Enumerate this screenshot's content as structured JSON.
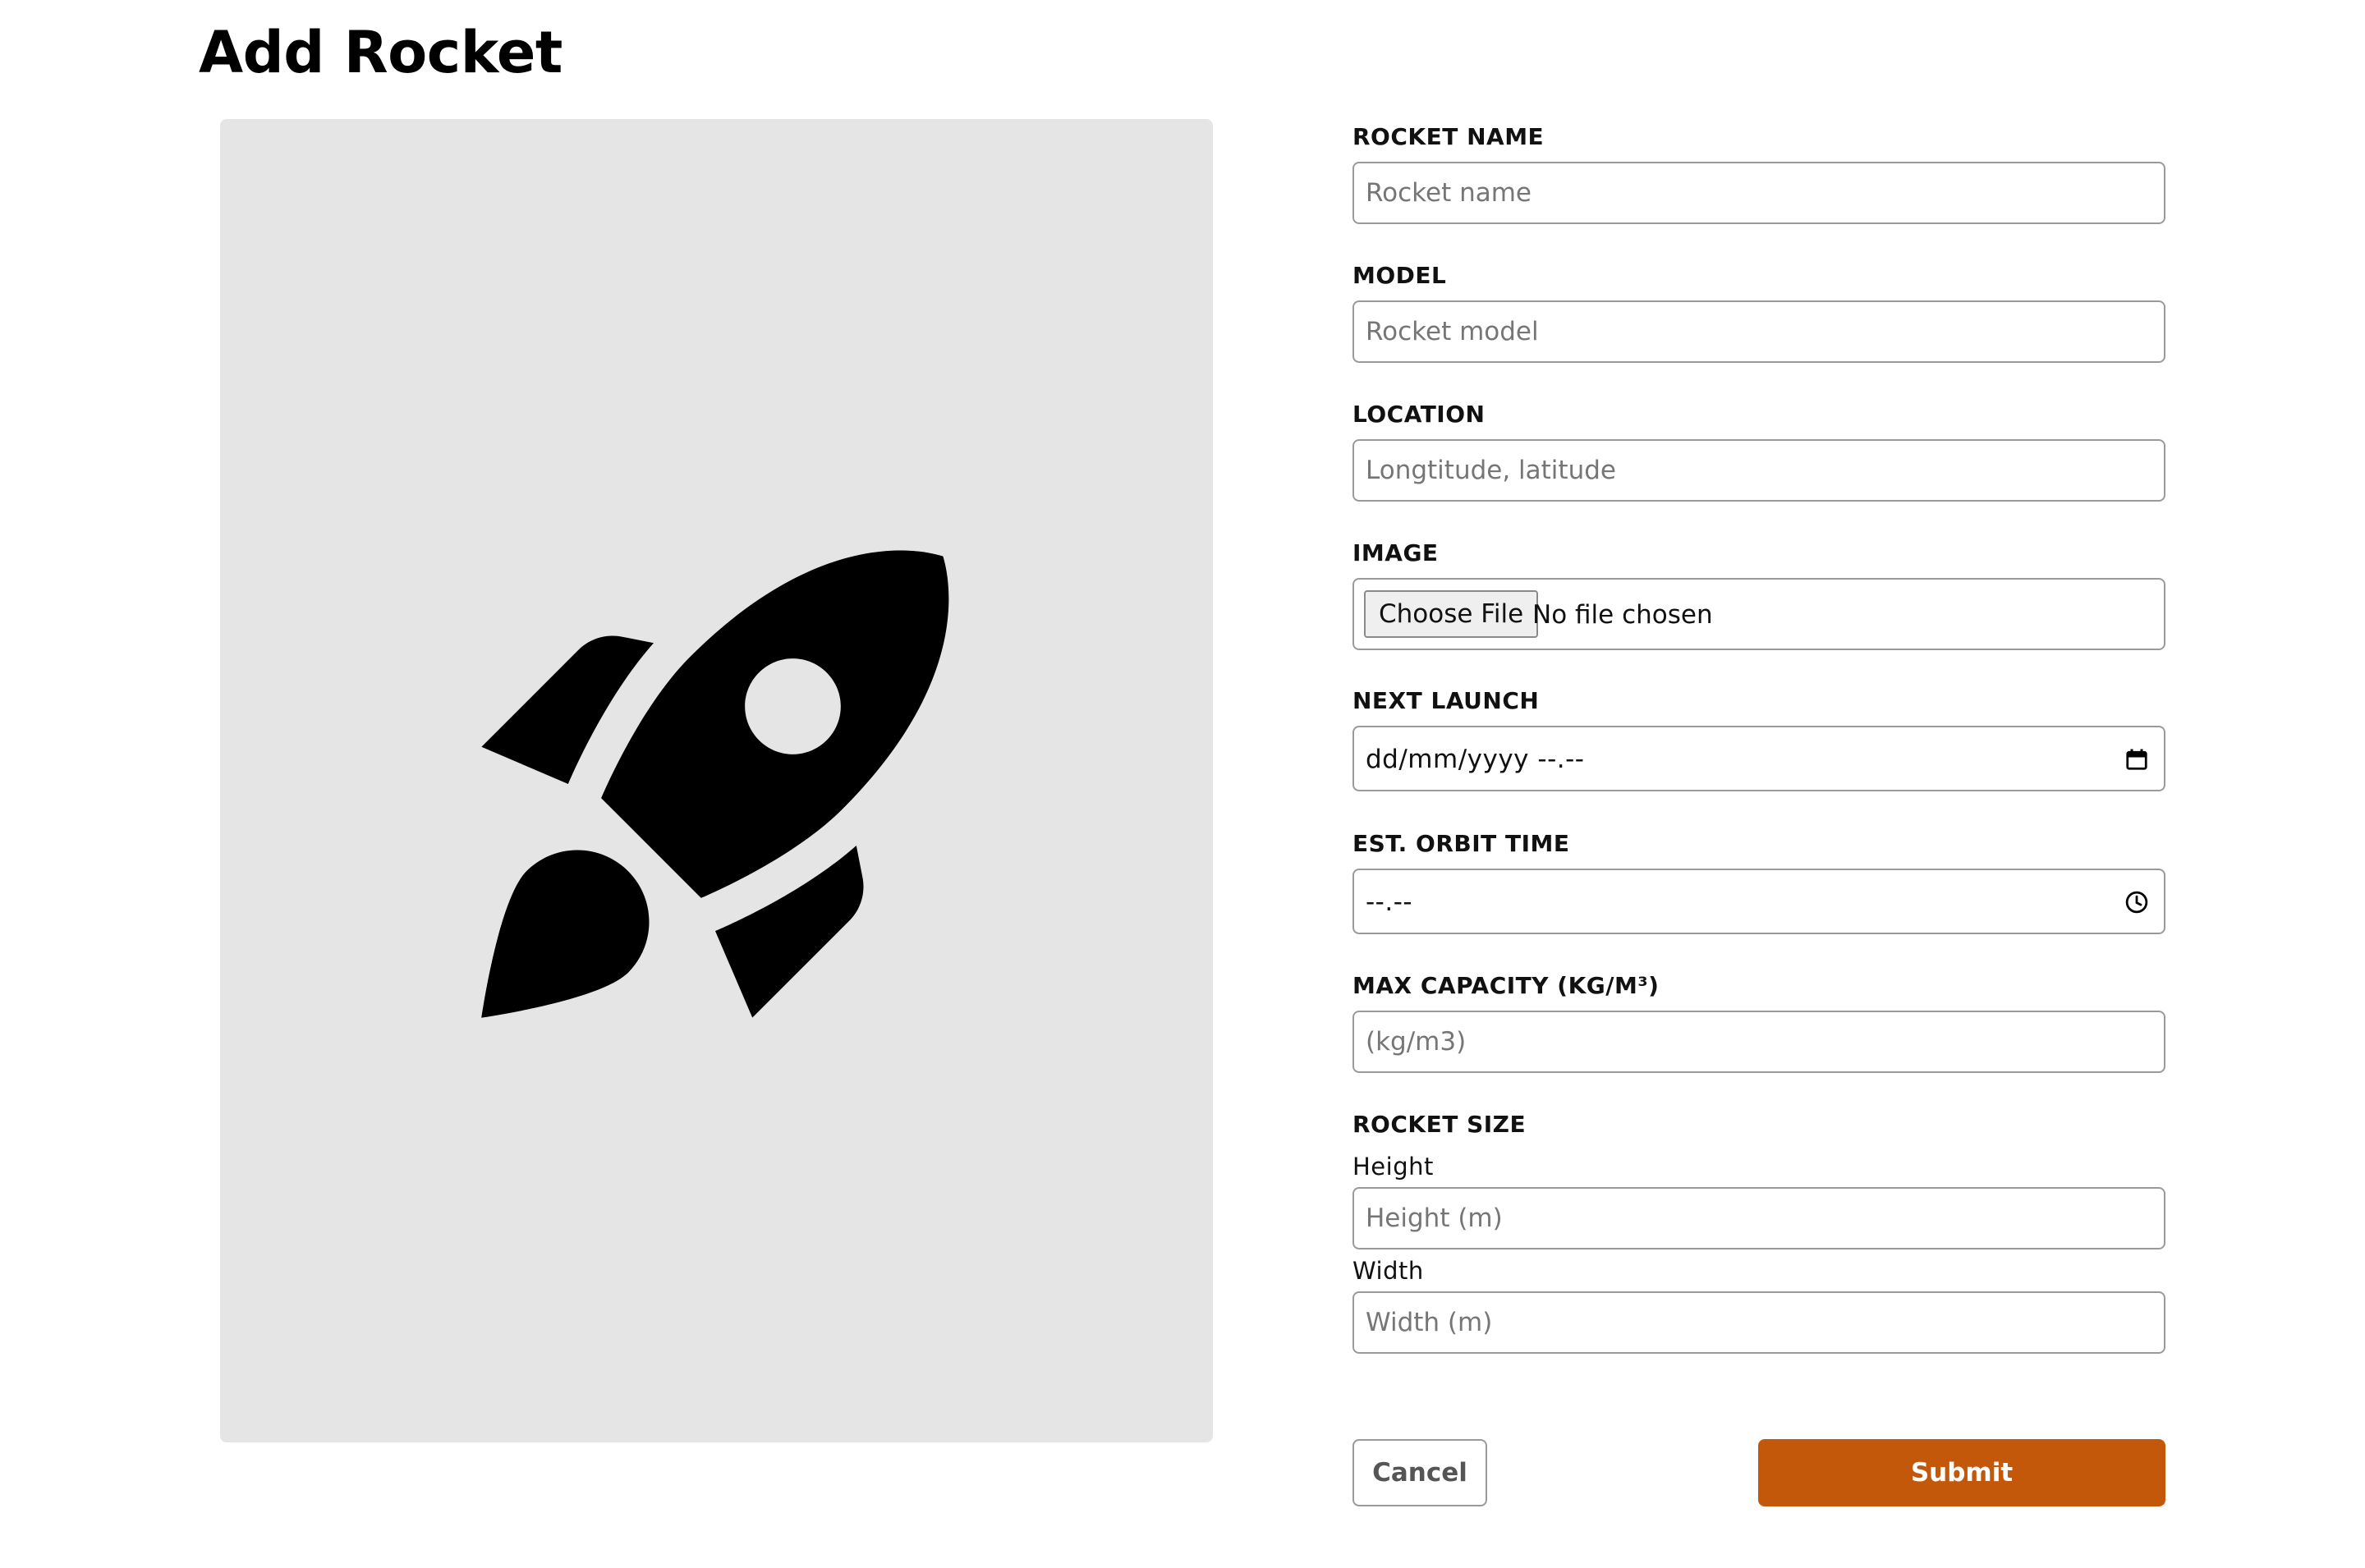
{
  "page": {
    "title": "Add Rocket"
  },
  "preview": {
    "icon": "rocket-icon",
    "background_color": "#e5e5e5"
  },
  "form": {
    "rocket_name": {
      "label": "ROCKET NAME",
      "placeholder": "Rocket name",
      "value": ""
    },
    "model": {
      "label": "MODEL",
      "placeholder": "Rocket model",
      "value": ""
    },
    "location": {
      "label": "LOCATION",
      "placeholder": "Longtitude, latitude",
      "value": ""
    },
    "image": {
      "label": "IMAGE",
      "button_label": "Choose File",
      "status": "No file chosen"
    },
    "next_launch": {
      "label": "NEXT LAUNCH",
      "value": "dd/mm/yyyy --.--",
      "icon": "calendar-icon"
    },
    "orbit_time": {
      "label": "EST. ORBIT TIME",
      "value": "--.--",
      "icon": "clock-icon"
    },
    "max_capacity": {
      "label": "MAX CAPACITY (KG/M³)",
      "placeholder": "(kg/m3)",
      "value": ""
    },
    "rocket_size": {
      "label": "ROCKET SIZE",
      "height": {
        "label": "Height",
        "placeholder": "Height (m)",
        "value": ""
      },
      "width": {
        "label": "Width",
        "placeholder": "Width (m)",
        "value": ""
      }
    }
  },
  "actions": {
    "cancel_label": "Cancel",
    "submit_label": "Submit",
    "submit_color": "#c4580a"
  }
}
